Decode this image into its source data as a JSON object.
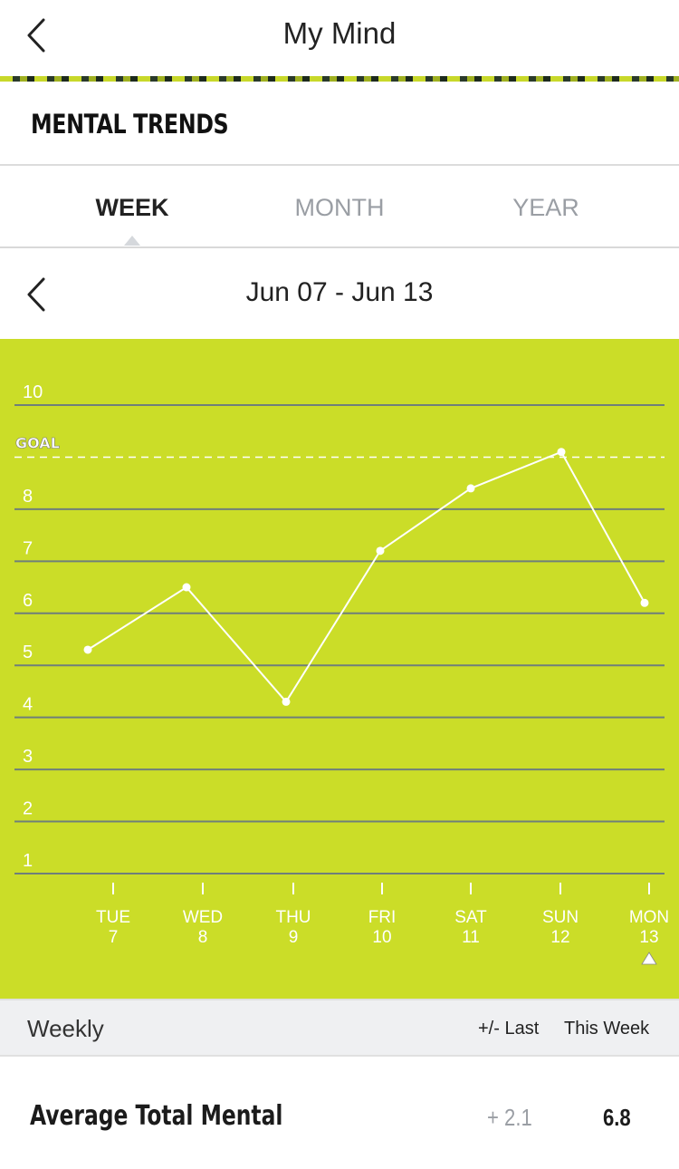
{
  "nav": {
    "title": "My Mind",
    "back_icon": "chevron-left-icon"
  },
  "section": {
    "title": "MENTAL TRENDS"
  },
  "tabs": [
    {
      "label": "WEEK",
      "selected": true
    },
    {
      "label": "MONTH",
      "selected": false
    },
    {
      "label": "YEAR",
      "selected": false
    }
  ],
  "date_nav": {
    "range": "Jun 07 - Jun 13",
    "prev_icon": "chevron-left-icon"
  },
  "colors": {
    "chart_background": "#cbdd28",
    "line": "#ffffff",
    "grid": "#6f7f7a"
  },
  "chart_data": {
    "type": "line",
    "goal_label": "GOAL",
    "goal": 9,
    "y_ticks": [
      1,
      2,
      3,
      4,
      5,
      6,
      7,
      8,
      10
    ],
    "ylim": [
      1,
      10
    ],
    "grid": true,
    "categories": [
      {
        "day": "TUE",
        "date": "7"
      },
      {
        "day": "WED",
        "date": "8"
      },
      {
        "day": "THU",
        "date": "9"
      },
      {
        "day": "FRI",
        "date": "10"
      },
      {
        "day": "SAT",
        "date": "11"
      },
      {
        "day": "SUN",
        "date": "12"
      },
      {
        "day": "MON",
        "date": "13"
      }
    ],
    "values": [
      5.3,
      6.5,
      4.3,
      7.2,
      8.4,
      9.1,
      6.2
    ],
    "selected_index": 6
  },
  "summary": {
    "period_label": "Weekly",
    "col_last": "+/- Last",
    "col_this": "This Week",
    "rows": [
      {
        "label": "Average Total Mental",
        "change": "+ 2.1",
        "value": "6.8"
      }
    ]
  }
}
